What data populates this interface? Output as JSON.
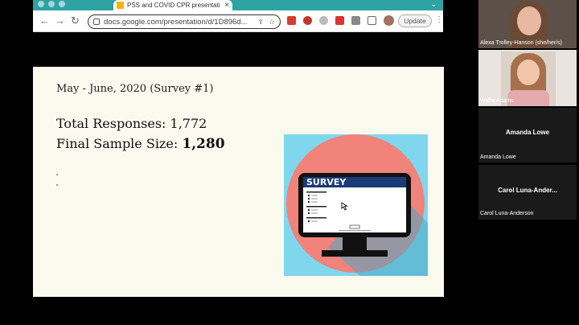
{
  "browser": {
    "tab_title": "PSS and COVID CPR presentati",
    "url": "docs.google.com/presentation/d/1D896d...",
    "update_label": "Update"
  },
  "slide": {
    "subtitle": "May - June, 2020 (Survey #1)",
    "total_label": "Total Responses: 1,772",
    "final_label": "Final Sample Size: ",
    "final_value": "1,280",
    "illustration_text": "SURVEY"
  },
  "participants": [
    {
      "name": "Alexa Trolley-Hanson (she/her/s)",
      "video": true
    },
    {
      "name": "Wallis Adams",
      "video": true
    },
    {
      "name": "Amanda Lowe",
      "display": "Amanda Lowe",
      "video": false
    },
    {
      "name": "Carol Luna-Anderson",
      "display": "Carol  Luna-Ander...",
      "video": false
    }
  ],
  "colors": {
    "tabbar": "#2fa2a4",
    "slide_bg": "#fbfaef",
    "illustration_bg": "#7fd7ee",
    "circle": "#f1837a",
    "screen_blue": "#1a3a78"
  }
}
